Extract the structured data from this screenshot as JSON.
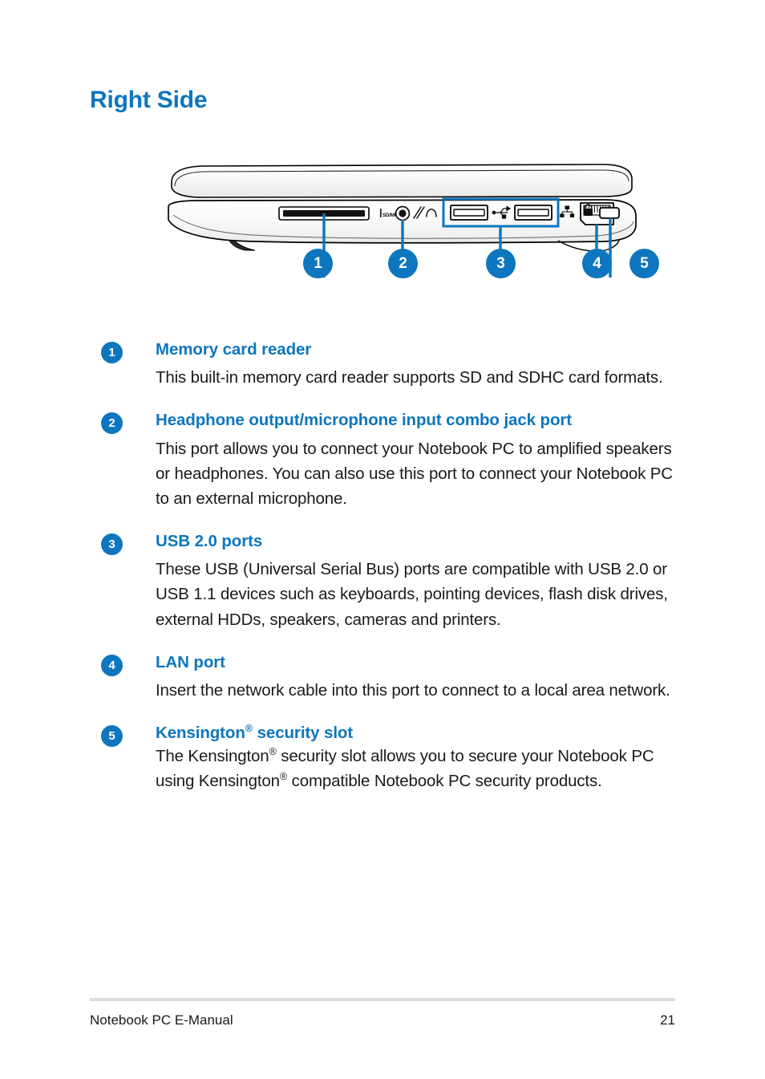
{
  "document": {
    "heading": "Right Side",
    "footer_left": "Notebook PC E-Manual",
    "footer_page": "21"
  },
  "colors": {
    "accent_blue": "#0d76be",
    "text": "#1a1a1a",
    "rule_gray": "#dcdcdc",
    "illustration_line": "#000000",
    "illustration_fill": "#f2f2f2"
  },
  "figure": {
    "name": "notebook-right-side-view",
    "caption": "",
    "ports": [
      {
        "num": "1",
        "icon": "sd-card-slot-icon",
        "label": "SD/MICRO",
        "callout": "1"
      },
      {
        "num": "2",
        "icon": "headphone-mic-combo-jack-icon",
        "label": "",
        "callout": "2"
      },
      {
        "num": "3",
        "icon": "usb-port-icon",
        "label": "",
        "callout": "3",
        "highlighted": true
      },
      {
        "num": "4",
        "icon": "lan-rj45-port-icon",
        "label": "",
        "callout": "4"
      },
      {
        "num": "5",
        "icon": "kensington-lock-slot-icon",
        "label": "",
        "callout": "5"
      }
    ],
    "callout_numbers": [
      "1",
      "2",
      "3",
      "4",
      "5"
    ]
  },
  "callouts": [
    {
      "num": "1",
      "title": "Memory card reader",
      "body": "This built-in memory card reader supports SD and SDHC card formats."
    },
    {
      "num": "2",
      "title": "Headphone output/microphone input combo jack port",
      "body": "This port allows you to connect your Notebook PC to amplified speakers or headphones. You can also use this port to connect your Notebook PC to an external microphone."
    },
    {
      "num": "3",
      "title": "USB 2.0 ports",
      "body": "These USB (Universal Serial Bus) ports are compatible with USB 2.0 or USB 1.1 devices such as keyboards, pointing devices, flash disk drives, external HDDs, speakers, cameras and printers."
    },
    {
      "num": "4",
      "title": "LAN port",
      "body": "Insert the network cable into this port to connect to a local area network."
    },
    {
      "num": "5",
      "title_pre": "Kensington",
      "title_reg": "®",
      "title_post": " security slot",
      "body_line1_pre": "The Kensington",
      "body_line1_post": " security slot allows you to secure your",
      "body_line2_pre": "Notebook PC using Kensington",
      "body_line2_post": " compatible Notebook PC",
      "body_line3": "security products."
    }
  ]
}
